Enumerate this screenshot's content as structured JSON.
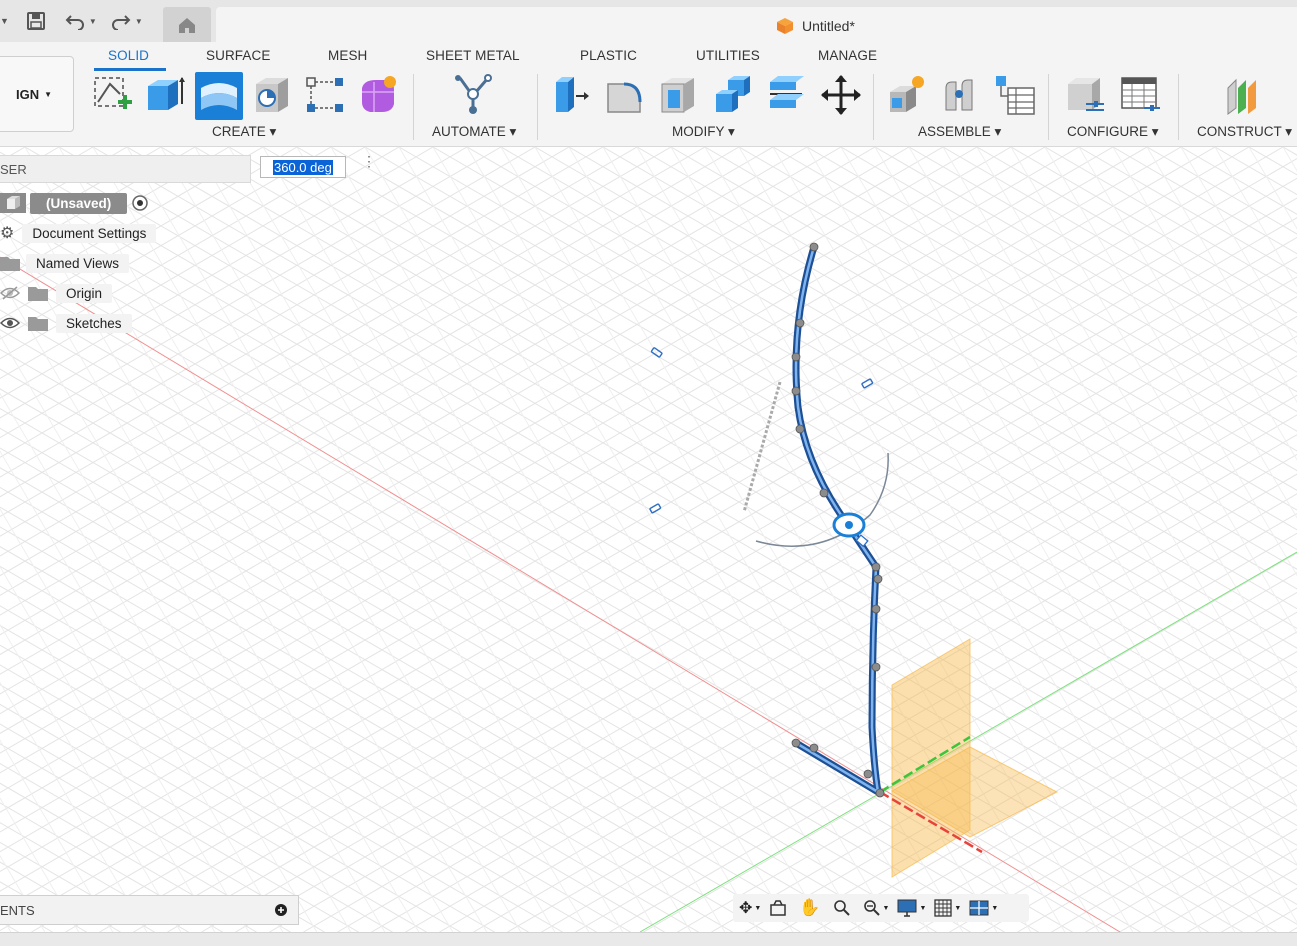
{
  "document": {
    "title": "Untitled*"
  },
  "quick_access": {
    "save_icon": "save-icon",
    "undo_icon": "undo-icon",
    "redo_icon": "redo-icon",
    "home_icon": "home-icon"
  },
  "workspace": {
    "label": "IGN"
  },
  "tabs": [
    {
      "label": "SOLID",
      "active": true
    },
    {
      "label": "SURFACE"
    },
    {
      "label": "MESH"
    },
    {
      "label": "SHEET METAL"
    },
    {
      "label": "PLASTIC"
    },
    {
      "label": "UTILITIES"
    },
    {
      "label": "MANAGE"
    }
  ],
  "groups": {
    "create": "CREATE",
    "automate": "AUTOMATE",
    "modify": "MODIFY",
    "assemble": "ASSEMBLE",
    "configure": "CONFIGURE",
    "construct": "CONSTRUCT"
  },
  "browser": {
    "header": "SER",
    "items": {
      "unsaved": "(Unsaved)",
      "document_settings": "Document Settings",
      "named_views": "Named Views",
      "origin": "Origin",
      "sketches": "Sketches"
    }
  },
  "angle_input": {
    "value": "360.0 deg"
  },
  "comments": {
    "label": "ENTS"
  },
  "colors": {
    "accent": "#1a73c9",
    "path_blue": "#2f6fc4",
    "plane_orange": "#f7b84a",
    "axis_red": "#e8433a",
    "axis_green": "#3cc43c"
  }
}
